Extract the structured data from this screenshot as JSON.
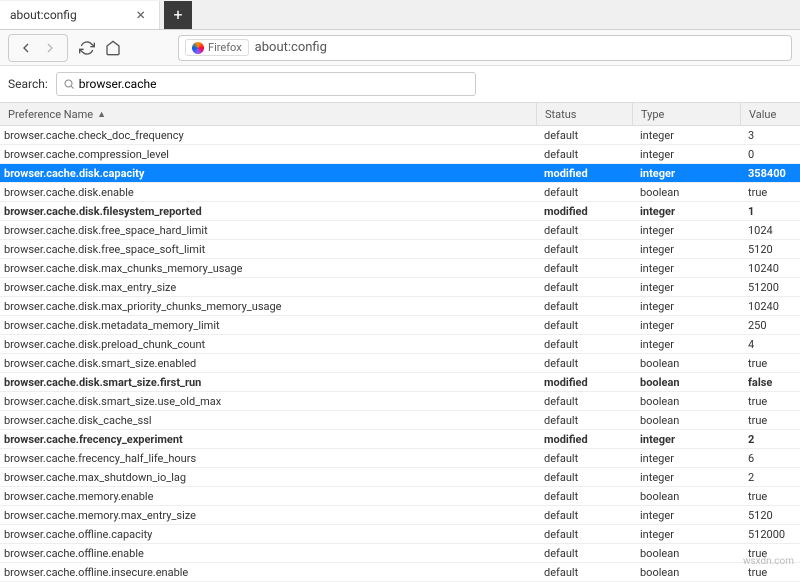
{
  "tab": {
    "title": "about:config"
  },
  "toolbar": {
    "firefox_label": "Firefox",
    "url": "about:config"
  },
  "search": {
    "label": "Search:",
    "value": "browser.cache"
  },
  "columns": {
    "name": "Preference Name",
    "status": "Status",
    "type": "Type",
    "value": "Value"
  },
  "prefs": [
    {
      "name": "browser.cache.check_doc_frequency",
      "status": "default",
      "type": "integer",
      "value": "3",
      "modified": false,
      "selected": false
    },
    {
      "name": "browser.cache.compression_level",
      "status": "default",
      "type": "integer",
      "value": "0",
      "modified": false,
      "selected": false
    },
    {
      "name": "browser.cache.disk.capacity",
      "status": "modified",
      "type": "integer",
      "value": "358400",
      "modified": true,
      "selected": true
    },
    {
      "name": "browser.cache.disk.enable",
      "status": "default",
      "type": "boolean",
      "value": "true",
      "modified": false,
      "selected": false
    },
    {
      "name": "browser.cache.disk.filesystem_reported",
      "status": "modified",
      "type": "integer",
      "value": "1",
      "modified": true,
      "selected": false
    },
    {
      "name": "browser.cache.disk.free_space_hard_limit",
      "status": "default",
      "type": "integer",
      "value": "1024",
      "modified": false,
      "selected": false
    },
    {
      "name": "browser.cache.disk.free_space_soft_limit",
      "status": "default",
      "type": "integer",
      "value": "5120",
      "modified": false,
      "selected": false
    },
    {
      "name": "browser.cache.disk.max_chunks_memory_usage",
      "status": "default",
      "type": "integer",
      "value": "10240",
      "modified": false,
      "selected": false
    },
    {
      "name": "browser.cache.disk.max_entry_size",
      "status": "default",
      "type": "integer",
      "value": "51200",
      "modified": false,
      "selected": false
    },
    {
      "name": "browser.cache.disk.max_priority_chunks_memory_usage",
      "status": "default",
      "type": "integer",
      "value": "10240",
      "modified": false,
      "selected": false
    },
    {
      "name": "browser.cache.disk.metadata_memory_limit",
      "status": "default",
      "type": "integer",
      "value": "250",
      "modified": false,
      "selected": false
    },
    {
      "name": "browser.cache.disk.preload_chunk_count",
      "status": "default",
      "type": "integer",
      "value": "4",
      "modified": false,
      "selected": false
    },
    {
      "name": "browser.cache.disk.smart_size.enabled",
      "status": "default",
      "type": "boolean",
      "value": "true",
      "modified": false,
      "selected": false
    },
    {
      "name": "browser.cache.disk.smart_size.first_run",
      "status": "modified",
      "type": "boolean",
      "value": "false",
      "modified": true,
      "selected": false
    },
    {
      "name": "browser.cache.disk.smart_size.use_old_max",
      "status": "default",
      "type": "boolean",
      "value": "true",
      "modified": false,
      "selected": false
    },
    {
      "name": "browser.cache.disk_cache_ssl",
      "status": "default",
      "type": "boolean",
      "value": "true",
      "modified": false,
      "selected": false
    },
    {
      "name": "browser.cache.frecency_experiment",
      "status": "modified",
      "type": "integer",
      "value": "2",
      "modified": true,
      "selected": false
    },
    {
      "name": "browser.cache.frecency_half_life_hours",
      "status": "default",
      "type": "integer",
      "value": "6",
      "modified": false,
      "selected": false
    },
    {
      "name": "browser.cache.max_shutdown_io_lag",
      "status": "default",
      "type": "integer",
      "value": "2",
      "modified": false,
      "selected": false
    },
    {
      "name": "browser.cache.memory.enable",
      "status": "default",
      "type": "boolean",
      "value": "true",
      "modified": false,
      "selected": false
    },
    {
      "name": "browser.cache.memory.max_entry_size",
      "status": "default",
      "type": "integer",
      "value": "5120",
      "modified": false,
      "selected": false
    },
    {
      "name": "browser.cache.offline.capacity",
      "status": "default",
      "type": "integer",
      "value": "512000",
      "modified": false,
      "selected": false
    },
    {
      "name": "browser.cache.offline.enable",
      "status": "default",
      "type": "boolean",
      "value": "true",
      "modified": false,
      "selected": false
    },
    {
      "name": "browser.cache.offline.insecure.enable",
      "status": "default",
      "type": "boolean",
      "value": "true",
      "modified": false,
      "selected": false
    }
  ],
  "watermark": "wsxdn.com"
}
